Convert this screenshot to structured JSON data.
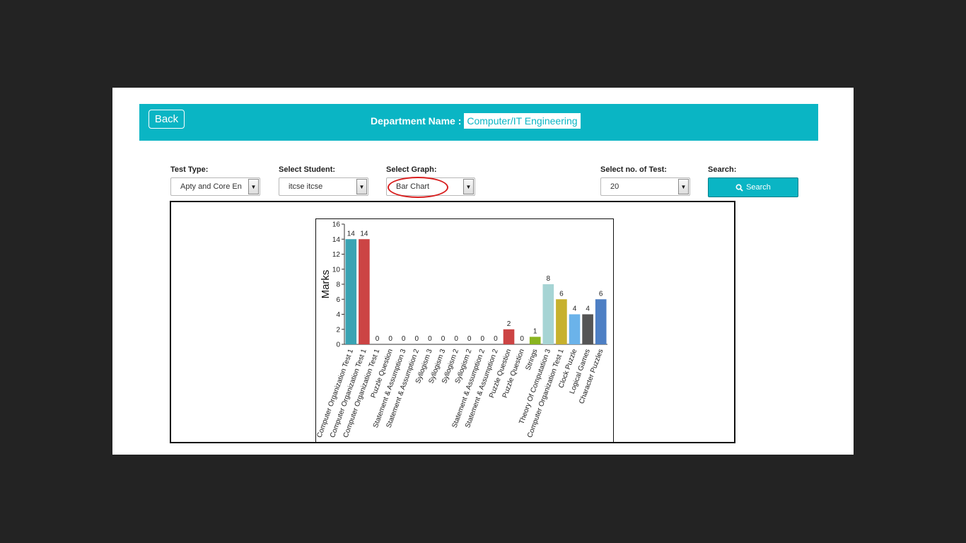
{
  "header": {
    "back_label": "Back",
    "dept_label": "Department Name :",
    "dept_value": "Computer/IT Engineering"
  },
  "filters": {
    "test_type": {
      "label": "Test Type:",
      "value": "Apty and Core En"
    },
    "student": {
      "label": "Select Student:",
      "value": "itcse itcse"
    },
    "graph": {
      "label": "Select Graph:",
      "value": "Bar Chart"
    },
    "num_tests": {
      "label": "Select no. of Test:",
      "value": "20"
    },
    "search": {
      "label": "Search:",
      "button_label": "Search",
      "icon": "search-icon"
    }
  },
  "colors": {
    "accent": "#0ab5c4",
    "highlight_circle": "#d81e1e",
    "background": "#232323"
  },
  "chart_data": {
    "type": "bar",
    "ylabel": "Marks",
    "xlabel": "",
    "ylim": [
      0,
      16
    ],
    "yticks": [
      0,
      2,
      4,
      6,
      8,
      10,
      12,
      14,
      16
    ],
    "grid": false,
    "categories": [
      "Computer Organization Test 1",
      "Computer Organization Test 1",
      "Computer Organization Test 1",
      "Puzzle Question",
      "Statement & Assumption 3",
      "Statement & Assumption 2",
      "Syllogism 3",
      "Syllogism 3",
      "Syllogism 2",
      "Syllogism 2",
      "Statement & Assumption 2",
      "Statement & Assumption 2",
      "Puzzle Question",
      "Puzzle Question",
      "Strings",
      "Theory Of Computation 3",
      "Computer Organization Test 1",
      "Clock Puzzle",
      "Logical Games",
      "Character Puzzles"
    ],
    "values": [
      14,
      14,
      0,
      0,
      0,
      0,
      0,
      0,
      0,
      0,
      0,
      0,
      2,
      0,
      1,
      8,
      6,
      4,
      4,
      6
    ],
    "colors": [
      "#3aa3b3",
      "#cc4444",
      "#3aa3b3",
      "#cc4444",
      "#3aa3b3",
      "#cc4444",
      "#3aa3b3",
      "#cc4444",
      "#3aa3b3",
      "#cc4444",
      "#3aa3b3",
      "#cc4444",
      "#cc4444",
      "#3aa3b3",
      "#8ab520",
      "#a6d4d4",
      "#c7b12e",
      "#6bb3ea",
      "#555555",
      "#4d7fc4"
    ]
  }
}
